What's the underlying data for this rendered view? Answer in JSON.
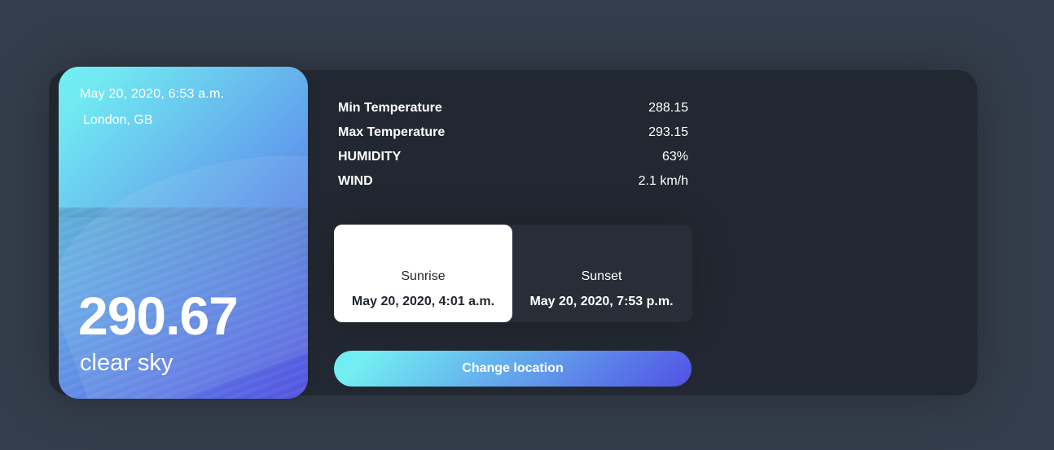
{
  "weather": {
    "date_time": "May 20, 2020, 6:53 a.m.",
    "location": "London, GB",
    "temperature": "290.67",
    "description": "clear sky"
  },
  "details": [
    {
      "title": "Min Temperature",
      "value": "288.15"
    },
    {
      "title": "Max Temperature",
      "value": "293.15"
    },
    {
      "title": "HUMIDITY",
      "value": "63%"
    },
    {
      "title": "WIND",
      "value": "2.1 km/h"
    }
  ],
  "sun": {
    "sunrise": {
      "label": "Sunrise",
      "time": "May 20, 2020, 4:01 a.m."
    },
    "sunset": {
      "label": "Sunset",
      "time": "May 20, 2020, 7:53 p.m."
    }
  },
  "actions": {
    "change_location_label": "Change location"
  },
  "colors": {
    "background": "#343d4b",
    "card": "#222831",
    "gradient_start": "#72edf2",
    "gradient_end": "#5151e5"
  }
}
